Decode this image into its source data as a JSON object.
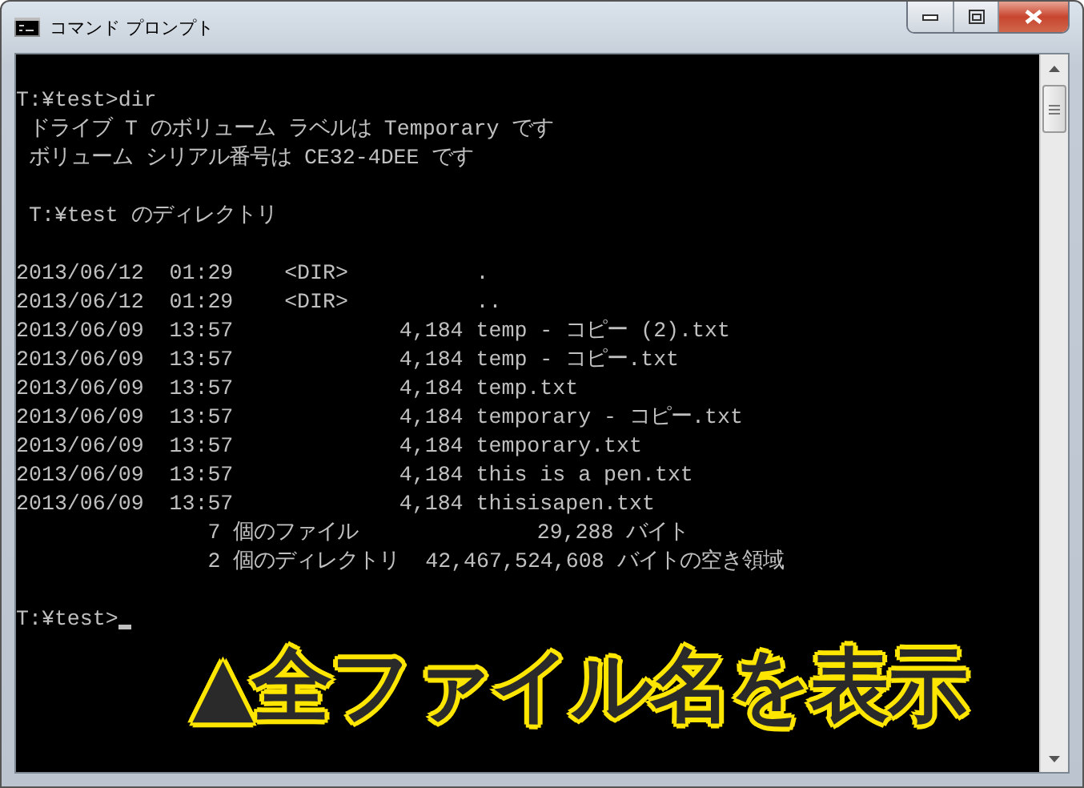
{
  "window": {
    "title": "コマンド プロンプト"
  },
  "console": {
    "blocks": [
      [
        "T:¥test>dir",
        " ドライブ T のボリューム ラベルは Temporary です",
        " ボリューム シリアル番号は CE32-4DEE です"
      ],
      [
        " T:¥test のディレクトリ"
      ],
      [
        "2013/06/12  01:29    <DIR>          .",
        "2013/06/12  01:29    <DIR>          ..",
        "2013/06/09  13:57             4,184 temp - コピー (2).txt",
        "2013/06/09  13:57             4,184 temp - コピー.txt",
        "2013/06/09  13:57             4,184 temp.txt",
        "2013/06/09  13:57             4,184 temporary - コピー.txt",
        "2013/06/09  13:57             4,184 temporary.txt",
        "2013/06/09  13:57             4,184 this is a pen.txt",
        "2013/06/09  13:57             4,184 thisisapen.txt",
        "               7 個のファイル              29,288 バイト",
        "               2 個のディレクトリ  42,467,524,608 バイトの空き領域"
      ]
    ],
    "prompt": {
      "text": "T:¥test>",
      "cursor": true
    }
  },
  "caption": "▲全ファイル名を表示"
}
